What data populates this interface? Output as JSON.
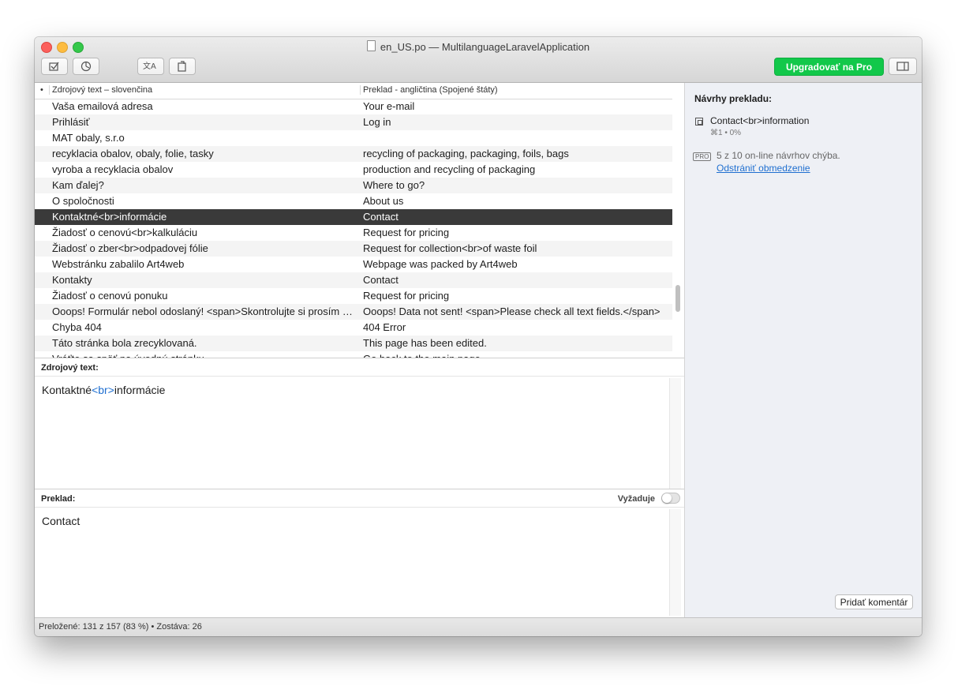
{
  "window": {
    "title": "en_US.po — MultilanguageLaravelApplication"
  },
  "toolbar": {
    "upgrade_label": "Upgradovať na Pro",
    "buttons": [
      "validate-icon",
      "stats-icon",
      "translate-icon",
      "pretranslate-icon"
    ]
  },
  "table": {
    "col_marker": "•",
    "col_source": "Zdrojový text – slovenčina",
    "col_translation": "Preklad - angličtina (Spojené štáty)",
    "rows": [
      {
        "source": "Vaša emailová adresa",
        "translation": "Your e-mail"
      },
      {
        "source": "Prihlásiť",
        "translation": "Log in"
      },
      {
        "source": "MAT obaly, s.r.o",
        "translation": ""
      },
      {
        "source": "recyklacia obalov, obaly, folie, tasky",
        "translation": "recycling of packaging, packaging, foils, bags"
      },
      {
        "source": "vyroba a recyklacia obalov",
        "translation": "production and recycling of packaging"
      },
      {
        "source": "Kam ďalej?",
        "translation": "Where to go?"
      },
      {
        "source": "O spoločnosti",
        "translation": "About us"
      },
      {
        "source": "Kontaktné<br>informácie",
        "translation": "Contact"
      },
      {
        "source": "Žiadosť o cenovú<br>kalkuláciu",
        "translation": "Request for pricing"
      },
      {
        "source": "Žiadosť o zber<br>odpadovej fólie",
        "translation": "Request for collection<br>of waste foil"
      },
      {
        "source": "Webstránku zabalilo Art4web",
        "translation": "Webpage was packed by Art4web"
      },
      {
        "source": "Kontakty",
        "translation": "Contact"
      },
      {
        "source": "Žiadosť o cenovú ponuku",
        "translation": "Request for pricing"
      },
      {
        "source": "Ooops! Formulár nebol odoslaný! <span>Skontrolujte si prosím vš…",
        "translation": "Ooops! Data not sent! <span>Please check all text fields.</span>"
      },
      {
        "source": "Chyba 404",
        "translation": "404 Error"
      },
      {
        "source": "Táto stránka bola zrecyklovaná.",
        "translation": "This page has been edited."
      },
      {
        "source": "Vráťte sa späť na úvodnú stránku",
        "translation": "Go back to the main page"
      }
    ],
    "selected_index": 7
  },
  "source_panel": {
    "label": "Zdrojový text:",
    "text_before": "Kontaktné",
    "text_tag": "<br>",
    "text_after": "informácie"
  },
  "translation_panel": {
    "label": "Preklad:",
    "toggle_label": "Vyžaduje",
    "text": "Contact"
  },
  "suggestions": {
    "title": "Návrhy prekladu:",
    "item_text": "Contact<br>information",
    "item_meta": "⌘1 • 0%",
    "pro_badge": "PRO",
    "pro_text": "5 z 10 on-line návrhov chýba.",
    "pro_link": "Odstrániť obmedzenie",
    "comment_button": "Pridať komentár"
  },
  "status": {
    "text": "Preložené: 131 z 157 (83 %)  •  Zostáva: 26"
  },
  "colors": {
    "upgrade": "#12c84a",
    "selected_row": "#3a3a3a",
    "tag": "#1f6fd0",
    "sidebar_bg": "#eef0f5"
  }
}
